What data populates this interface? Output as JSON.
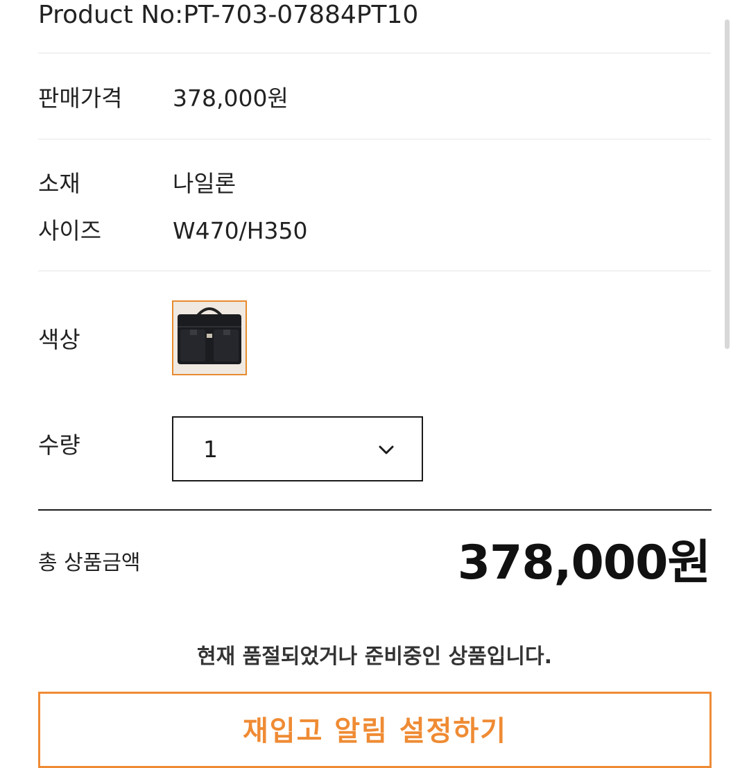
{
  "product": {
    "number": "Product No:PT-703-07884PT10"
  },
  "price": {
    "label": "판매가격",
    "value": "378,000원"
  },
  "specs": {
    "material_label": "소재",
    "material_value": "나일론",
    "size_label": "사이즈",
    "size_value": "W470/H350"
  },
  "color": {
    "label": "색상",
    "swatch_icon": "black-briefcase-thumbnail",
    "accent": "#e88a2e"
  },
  "quantity": {
    "label": "수량",
    "selected": "1",
    "icon": "chevron-down-icon"
  },
  "total": {
    "label": "총 상품금액",
    "value": "378,000원"
  },
  "notice": "현재 품절되었거나 준비중인 상품입니다.",
  "restock": {
    "label": "재입고 알림 설정하기",
    "color": "#ef8b34"
  }
}
